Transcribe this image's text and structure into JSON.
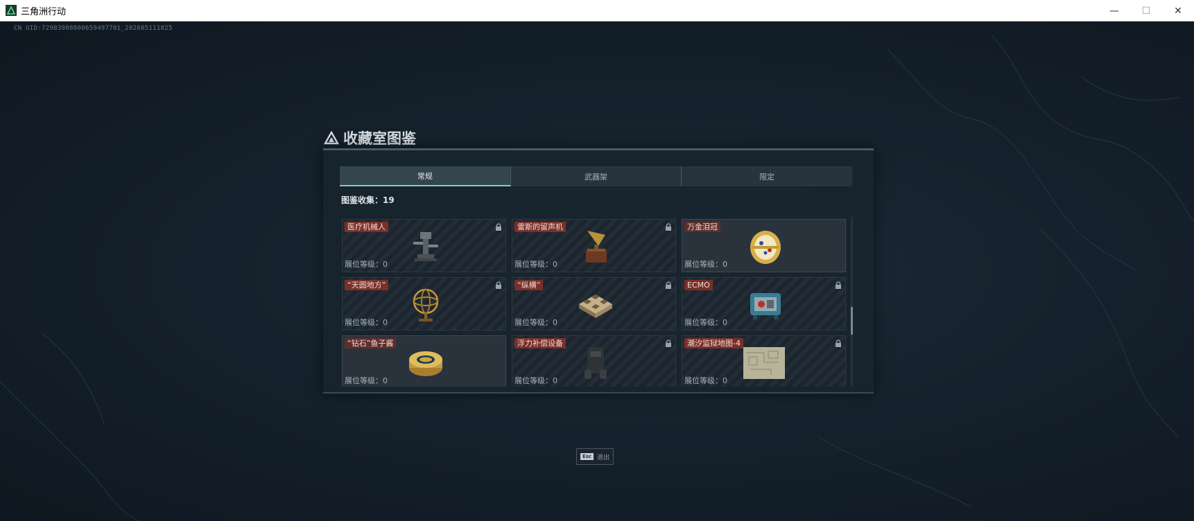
{
  "window": {
    "title": "三角洲行动",
    "minimize": "—",
    "maximize": "☐",
    "close": "✕"
  },
  "uid_text": "CN UID:7298398880065949770​1_202605111825",
  "panel": {
    "title": "收藏室图鉴",
    "tabs": [
      {
        "label": "常规",
        "active": true
      },
      {
        "label": "武器架",
        "active": false
      },
      {
        "label": "限定",
        "active": false
      }
    ],
    "count_label": "图鉴收集：19",
    "cards": [
      {
        "name": "医疗机械人",
        "level": "展位等级：0",
        "locked": true,
        "icon": "medical-robot-icon"
      },
      {
        "name": "雷斯的留声机",
        "level": "展位等级：0",
        "locked": true,
        "icon": "gramophone-icon"
      },
      {
        "name": "万金泪冠",
        "level": "展位等级：0",
        "locked": false,
        "icon": "jeweled-crown-icon"
      },
      {
        "name": "“天圆地方”",
        "level": "展位等级：0",
        "locked": true,
        "icon": "armillary-sphere-icon"
      },
      {
        "name": "“纵横”",
        "level": "展位等级：0",
        "locked": true,
        "icon": "chessboard-icon"
      },
      {
        "name": "ECMO",
        "level": "展位等级：0",
        "locked": true,
        "icon": "ecmo-machine-icon"
      },
      {
        "name": "“钻石”鱼子酱",
        "level": "展位等级：0",
        "locked": false,
        "icon": "caviar-tin-icon"
      },
      {
        "name": "浮力补偿设备",
        "level": "展位等级：0",
        "locked": true,
        "icon": "buoyancy-device-icon"
      },
      {
        "name": "潮汐监狱地图-4",
        "level": "展位等级：0",
        "locked": true,
        "icon": "prison-map-icon"
      }
    ]
  },
  "esc_hint": {
    "key": "Esc",
    "label": "退出"
  },
  "colors": {
    "accent": "#7fd1b4",
    "name_tag": "#7a2f2a",
    "background": "#15212c"
  }
}
